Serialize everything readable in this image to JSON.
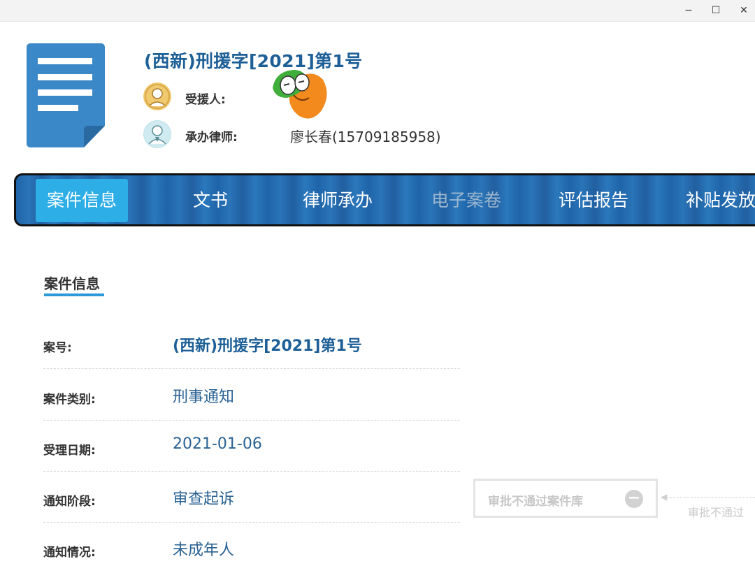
{
  "window": {
    "minimize": "−",
    "maximize": "☐",
    "close": "✕"
  },
  "header": {
    "case_title": "(西新)刑援字[2021]第1号",
    "recipient_label": "受援人:",
    "lawyer_label": "承办律师:",
    "lawyer_value": "廖长春(15709185958)"
  },
  "tabs": [
    {
      "label": "案件信息",
      "state": "active"
    },
    {
      "label": "文书",
      "state": "normal"
    },
    {
      "label": "律师承办",
      "state": "normal"
    },
    {
      "label": "电子案卷",
      "state": "disabled"
    },
    {
      "label": "评估报告",
      "state": "normal"
    },
    {
      "label": "补贴发放",
      "state": "normal"
    }
  ],
  "section": {
    "title": "案件信息"
  },
  "fields": [
    {
      "label": "案号:",
      "value": "(西新)刑援字[2021]第1号"
    },
    {
      "label": "案件类别:",
      "value": "刑事通知"
    },
    {
      "label": "受理日期:",
      "value": "2021-01-06"
    },
    {
      "label": "通知阶段:",
      "value": "审查起诉"
    },
    {
      "label": "通知情况:",
      "value": "未成年人"
    }
  ],
  "approval": {
    "button_label": "审批不通过案件库",
    "flow_label": "审批不通过"
  },
  "colors": {
    "accent": "#2eaee6",
    "title_blue": "#1d5f97",
    "nav_blue": "#1f64a8"
  }
}
